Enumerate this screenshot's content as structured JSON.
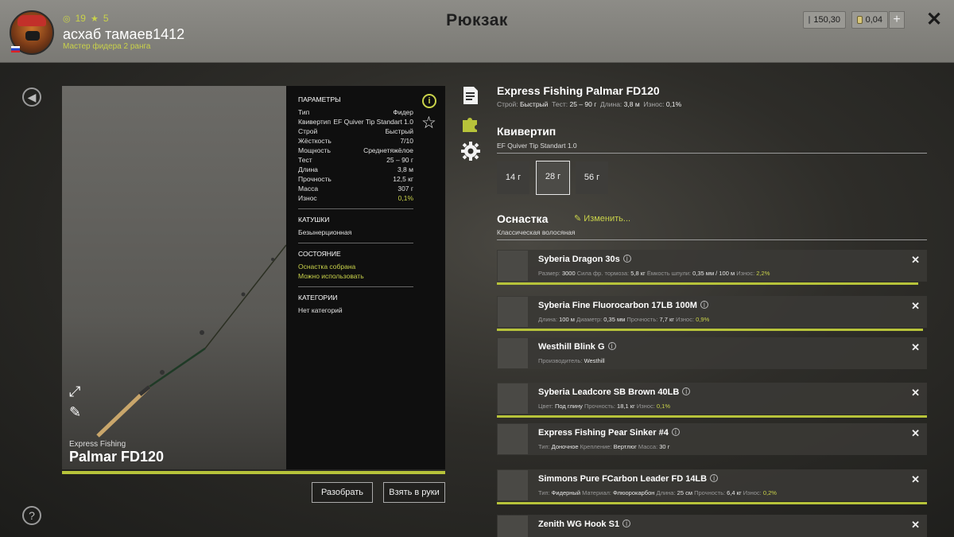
{
  "user": {
    "coins_count": "19",
    "stars_count": "5",
    "name": "асхаб тамаев1412",
    "rank": "Мастер фидера 2 ранга"
  },
  "header": {
    "title": "Рюкзак",
    "silver": "150,30",
    "gold": "0,04",
    "plus": "+",
    "close": "✕"
  },
  "rod": {
    "brand": "Express Fishing",
    "model": "Palmar FD120",
    "params_title": "ПАРАМЕТРЫ",
    "params": [
      {
        "k": "Тип",
        "v": "Фидер"
      },
      {
        "k": "Квивертип",
        "v": "EF Quiver Tip Standart 1.0"
      },
      {
        "k": "Строй",
        "v": "Быстрый"
      },
      {
        "k": "Жёсткость",
        "v": "7/10"
      },
      {
        "k": "Мощность",
        "v": "Среднетяжёлое"
      },
      {
        "k": "Тест",
        "v": "25 – 90 г"
      },
      {
        "k": "Длина",
        "v": "3,8 м"
      },
      {
        "k": "Прочность",
        "v": "12,5 кг"
      },
      {
        "k": "Масса",
        "v": "307 г"
      },
      {
        "k": "Износ",
        "v": "0,1%"
      }
    ],
    "reels_title": "КАТУШКИ",
    "reels_value": "Безынерционная",
    "state_title": "СОСТОЯНИЕ",
    "state_1": "Оснастка собрана",
    "state_2": "Можно использовать",
    "cat_title": "КАТЕГОРИИ",
    "cat_value": "Нет категорий",
    "btn_disassemble": "Разобрать",
    "btn_take": "Взять в руки"
  },
  "details": {
    "title": "Express Fishing Palmar FD120",
    "spec": {
      "stroy_k": "Строй:",
      "stroy_v": "Быстрый",
      "test_k": "Тест:",
      "test_v": "25 – 90 г",
      "len_k": "Длина:",
      "len_v": "3,8 м",
      "wear_k": "Износ:",
      "wear_v": "0,1%"
    },
    "quiver_title": "Квивертип",
    "quiver_name": "EF Quiver Tip Standart 1.0",
    "tips": [
      "14 г",
      "28 г",
      "56 г"
    ],
    "rig_title": "Оснастка",
    "edit": "Изменить...",
    "rig_name": "Классическая волосяная"
  },
  "items": [
    {
      "name": "Syberia Dragon 30s",
      "meta": [
        [
          "Размер:",
          "3000"
        ],
        [
          "Сила фр. тормоза:",
          "5,8 кг"
        ],
        [
          "Ёмкость шпули:",
          "0,35 мм / 100 м"
        ],
        [
          "Износ:",
          "2,2%"
        ]
      ],
      "progress": 0.98
    },
    {
      "name": "Syberia Fine Fluorocarbon 17LB 100M",
      "meta": [
        [
          "Длина:",
          "100 м"
        ],
        [
          "Диаметр:",
          "0,35 мм"
        ],
        [
          "Прочность:",
          "7,7 кг"
        ],
        [
          "Износ:",
          "0,9%"
        ]
      ],
      "progress": 0.99
    },
    {
      "name": "Westhill Blink G",
      "meta": [
        [
          "Производитель:",
          "Westhill"
        ]
      ],
      "progress": null
    },
    {
      "name": "Syberia Leadcore SB Brown 40LB",
      "meta": [
        [
          "Цвет:",
          "Под глину"
        ],
        [
          "Прочность:",
          "18,1 кг"
        ],
        [
          "Износ:",
          "0,1%"
        ]
      ],
      "progress": 1.0
    },
    {
      "name": "Express Fishing Pear Sinker #4",
      "meta": [
        [
          "Тип:",
          "Доночное"
        ],
        [
          "Крепление:",
          "Вертлюг"
        ],
        [
          "Масса:",
          "30 г"
        ]
      ],
      "progress": null
    },
    {
      "name": "Simmons Pure FCarbon Leader FD 14LB",
      "meta": [
        [
          "Тип:",
          "Фидерный"
        ],
        [
          "Материал:",
          "Флюорокарбон"
        ],
        [
          "Длина:",
          "25 см"
        ],
        [
          "Прочность:",
          "6,4 кг"
        ],
        [
          "Износ:",
          "0,2%"
        ]
      ],
      "progress": 1.0
    },
    {
      "name": "Zenith WG Hook S1",
      "meta": [],
      "progress": null
    }
  ],
  "colors": {
    "accent": "#c9d24a",
    "bar": "#b7c33a"
  }
}
